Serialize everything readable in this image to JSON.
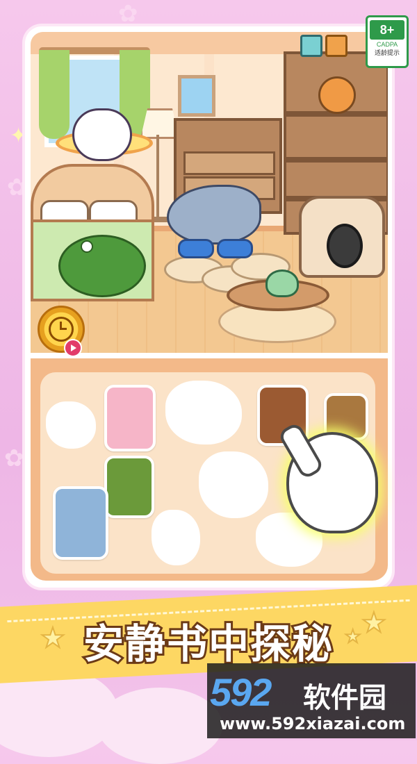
{
  "rating_badge": {
    "age": "8+",
    "org": "CADPA",
    "tip": "适龄提示",
    "color": "#2e9a4a"
  },
  "banner": {
    "title": "安静书中探秘",
    "color": "#fdd763"
  },
  "watermark": {
    "number": "592",
    "name": "软件园",
    "url": "www.592xiazai.com"
  },
  "icons": {
    "timer": "clock-icon",
    "video": "video-play-icon",
    "pointer": "pointing-hand-icon"
  },
  "colors": {
    "background": "#f6c8ec",
    "tray": "#f3b989",
    "tray_inner": "#fbe3c8"
  }
}
